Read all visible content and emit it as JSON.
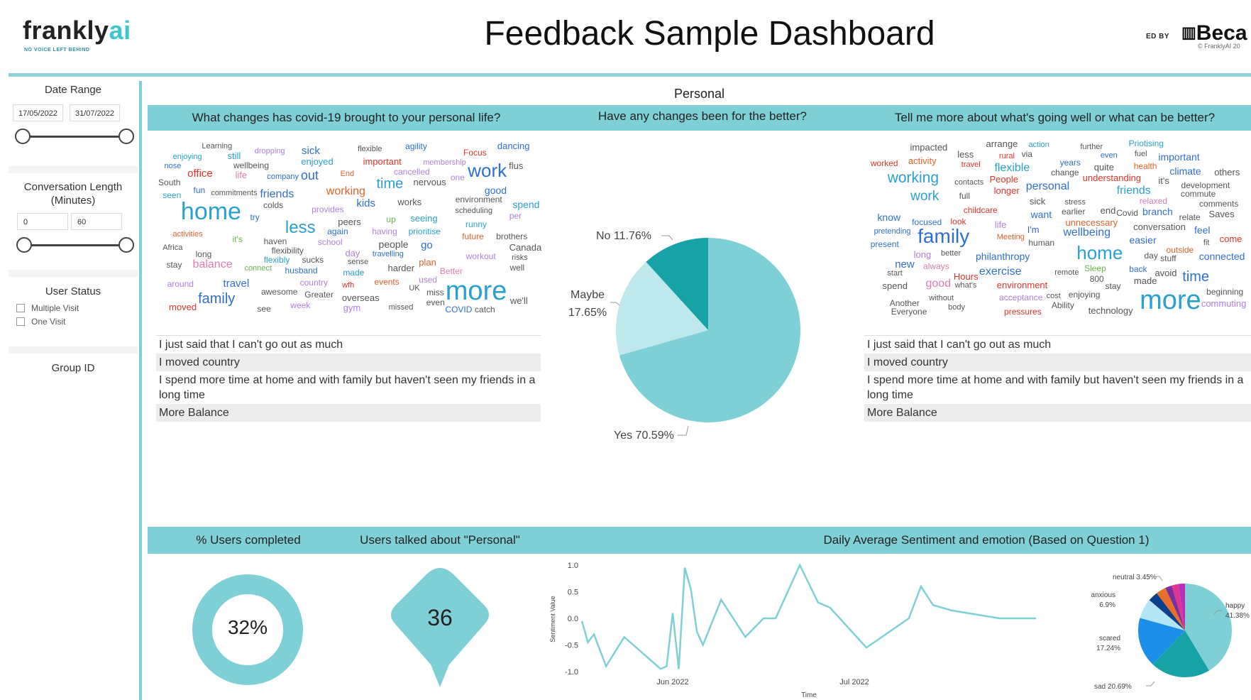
{
  "header": {
    "logo": "frankly",
    "logo_ai": "ai",
    "tagline": "NO VOICE LEFT BEHIND",
    "title": "Feedback Sample Dashboard",
    "powered_by": "ED BY",
    "partner": "Beca",
    "copyright": "© FranklyAI 20"
  },
  "sidebar": {
    "date_range": {
      "title": "Date Range",
      "start": "17/05/2022",
      "end": "31/07/2022"
    },
    "conversation_length": {
      "title_line1": "Conversation Length",
      "title_line2": "(Minutes)",
      "min": "0",
      "max": "60"
    },
    "user_status": {
      "title": "User Status",
      "options": [
        "Multiple Visit",
        "One Visit"
      ]
    },
    "group_id": {
      "title": "Group ID"
    }
  },
  "main": {
    "section": "Personal",
    "q1": "What changes has covid-19 brought to your personal life?",
    "q2": "Have any changes been for the better?",
    "q3": "Tell me more about what's going well or what can be better?",
    "responses_left": [
      "I just said that I can't go out as much",
      "I moved country",
      "I spend more time at home and with family but haven't seen my friends in a long time",
      "More Balance"
    ],
    "responses_right": [
      "I just said that I can't go out as much",
      "I moved country",
      "I spend more time at home and with family but haven't seen my friends in a long time",
      "More Balance"
    ],
    "kpi_band": {
      "users_completed_title": "% Users completed",
      "users_personal_title": "Users talked about \"Personal\"",
      "sentiment_title": "Daily Average Sentiment and emotion (Based on Question 1)"
    },
    "users_completed_value": "32%",
    "users_completed_fraction": 0.32,
    "users_personal_value": "36"
  },
  "wordcloud_left": [
    [
      "provides",
      "#b07fe0"
    ],
    [
      "life",
      "#e07bb0"
    ],
    [
      "used",
      "#b07fe0"
    ],
    [
      "gym",
      "#b07fe0"
    ],
    [
      "flexibility",
      "#555"
    ],
    [
      "country",
      "#b07fe0"
    ],
    [
      "out",
      "#2f6fd0"
    ],
    [
      "long",
      "#555"
    ],
    [
      "events",
      "#e0622a"
    ],
    [
      "membership",
      "#b07fe0"
    ],
    [
      "moved",
      "#e0342a"
    ],
    [
      "South",
      "#555"
    ],
    [
      "seen",
      "#2aa0d0"
    ],
    [
      "connect",
      "#6ab04c"
    ],
    [
      "flexible",
      "#555"
    ],
    [
      "week",
      "#b07fe0"
    ],
    [
      "sucks",
      "#555"
    ],
    [
      "workout",
      "#b07fe0"
    ],
    [
      "around",
      "#b07fe0"
    ],
    [
      "nose",
      "#2f6fd0"
    ],
    [
      "travel",
      "#2f6fd0"
    ],
    [
      "brothers",
      "#555"
    ],
    [
      "runny",
      "#2aa0d0"
    ],
    [
      "up",
      "#6ab04c"
    ],
    [
      "time",
      "#2aa0d0"
    ],
    [
      "harder",
      "#555"
    ],
    [
      "important",
      "#e0342a"
    ],
    [
      "future",
      "#e0622a"
    ],
    [
      "colds",
      "#555"
    ],
    [
      "dancing",
      "#2f6fd0"
    ],
    [
      "Focus",
      "#e0342a"
    ],
    [
      "environment",
      "#555"
    ],
    [
      "working",
      "#e0622a"
    ],
    [
      "spend",
      "#2aa0d0"
    ],
    [
      "overseas",
      "#555"
    ],
    [
      "scheduling",
      "#555"
    ],
    [
      "enjoyed",
      "#2aa0d0"
    ],
    [
      "kids",
      "#2f6fd0"
    ],
    [
      "again",
      "#2f6fd0"
    ],
    [
      "travelling",
      "#2f6fd0"
    ],
    [
      "still",
      "#2aa0d0"
    ],
    [
      "work",
      "#2f6fd0"
    ],
    [
      "fun",
      "#2f6fd0"
    ],
    [
      "dropping",
      "#b07fe0"
    ],
    [
      "flexibly",
      "#2aa0d0"
    ],
    [
      "it's",
      "#6ab04c"
    ],
    [
      "agility",
      "#2f6fd0"
    ],
    [
      "see",
      "#555"
    ],
    [
      "well",
      "#555"
    ],
    [
      "people",
      "#555"
    ],
    [
      "go",
      "#2f6fd0"
    ],
    [
      "balance",
      "#e07bb0"
    ],
    [
      "prioritise",
      "#2aa0d0"
    ],
    [
      "haven",
      "#555"
    ],
    [
      "enjoying",
      "#2aa0d0"
    ],
    [
      "flus",
      "#555"
    ],
    [
      "commitments",
      "#555"
    ],
    [
      "made",
      "#2aa0d0"
    ],
    [
      "even",
      "#555"
    ],
    [
      "company",
      "#2f6fd0"
    ],
    [
      "Learning",
      "#555"
    ],
    [
      "activities",
      "#e0622a"
    ],
    [
      "school",
      "#b07fe0"
    ],
    [
      "sense",
      "#555"
    ],
    [
      "works",
      "#555"
    ],
    [
      "home",
      "#2aa0d0"
    ],
    [
      "nervous",
      "#555"
    ],
    [
      "Better",
      "#e07bb0"
    ],
    [
      "office",
      "#e0342a"
    ],
    [
      "peers",
      "#555"
    ],
    [
      "husband",
      "#2f6fd0"
    ],
    [
      "Greater",
      "#555"
    ],
    [
      "catch",
      "#555"
    ],
    [
      "seeing",
      "#2aa0d0"
    ],
    [
      "sick",
      "#2f6fd0"
    ],
    [
      "End",
      "#e0622a"
    ],
    [
      "missed",
      "#555"
    ],
    [
      "Canada",
      "#555"
    ],
    [
      "UK",
      "#555"
    ],
    [
      "one",
      "#b07fe0"
    ],
    [
      "good",
      "#2f6fd0"
    ],
    [
      "COVID",
      "#2f6fd0"
    ],
    [
      "plan",
      "#e0622a"
    ],
    [
      "cancelled",
      "#b07fe0"
    ],
    [
      "friends",
      "#2f6fd0"
    ],
    [
      "wfh",
      "#e0342a"
    ],
    [
      "wellbeing",
      "#555"
    ],
    [
      "more",
      "#2aa0d0"
    ],
    [
      "day",
      "#b07fe0"
    ],
    [
      "miss",
      "#555"
    ],
    [
      "family",
      "#2f6fd0"
    ],
    [
      "per",
      "#b07fe0"
    ],
    [
      "having",
      "#b07fe0"
    ],
    [
      "less",
      "#2aa0d0"
    ],
    [
      "we'll",
      "#555"
    ],
    [
      "stay",
      "#555"
    ],
    [
      "try",
      "#2f6fd0"
    ],
    [
      "Africa",
      "#555"
    ],
    [
      "awesome",
      "#555"
    ],
    [
      "risks",
      "#555"
    ]
  ],
  "wordcloud_right": [
    [
      "outside",
      "#e0622a"
    ],
    [
      "Meeting",
      "#e0622a"
    ],
    [
      "cost",
      "#555"
    ],
    [
      "even",
      "#2f6fd0"
    ],
    [
      "enjoying",
      "#555"
    ],
    [
      "good",
      "#e07bb0"
    ],
    [
      "day",
      "#555"
    ],
    [
      "arrange",
      "#555"
    ],
    [
      "acceptance",
      "#b07fe0"
    ],
    [
      "Sleep",
      "#6ab04c"
    ],
    [
      "years",
      "#2f6fd0"
    ],
    [
      "fuel",
      "#555"
    ],
    [
      "look",
      "#e0342a"
    ],
    [
      "health",
      "#e0622a"
    ],
    [
      "earlier",
      "#555"
    ],
    [
      "longer",
      "#e0342a"
    ],
    [
      "long",
      "#b07fe0"
    ],
    [
      "friends",
      "#2aa0d0"
    ],
    [
      "conversation",
      "#555"
    ],
    [
      "work",
      "#2aa0d0"
    ],
    [
      "technology",
      "#555"
    ],
    [
      "avoid",
      "#555"
    ],
    [
      "life",
      "#b07fe0"
    ],
    [
      "commute",
      "#555"
    ],
    [
      "People",
      "#e0342a"
    ],
    [
      "always",
      "#e07bb0"
    ],
    [
      "impacted",
      "#555"
    ],
    [
      "travel",
      "#e0342a"
    ],
    [
      "via",
      "#555"
    ],
    [
      "childcare",
      "#e0342a"
    ],
    [
      "Saves",
      "#555"
    ],
    [
      "body",
      "#555"
    ],
    [
      "personal",
      "#2f6fd0"
    ],
    [
      "easier",
      "#2f6fd0"
    ],
    [
      "stay",
      "#555"
    ],
    [
      "Another",
      "#555"
    ],
    [
      "full",
      "#555"
    ],
    [
      "it's",
      "#555"
    ],
    [
      "end",
      "#555"
    ],
    [
      "know",
      "#2f6fd0"
    ],
    [
      "important",
      "#2f6fd0"
    ],
    [
      "branch",
      "#2f6fd0"
    ],
    [
      "time",
      "#2f6fd0"
    ],
    [
      "focused",
      "#2f6fd0"
    ],
    [
      "commuting",
      "#b07fe0"
    ],
    [
      "further",
      "#555"
    ],
    [
      "Everyone",
      "#555"
    ],
    [
      "I'm",
      "#2f6fd0"
    ],
    [
      "Ability",
      "#555"
    ],
    [
      "new",
      "#2f6fd0"
    ],
    [
      "Priotising",
      "#2aa0d0"
    ],
    [
      "action",
      "#2aa0d0"
    ],
    [
      "quite",
      "#555"
    ],
    [
      "stress",
      "#555"
    ],
    [
      "development",
      "#555"
    ],
    [
      "without",
      "#555"
    ],
    [
      "remote",
      "#555"
    ],
    [
      "what's",
      "#555"
    ],
    [
      "contacts",
      "#555"
    ],
    [
      "relaxed",
      "#e07bb0"
    ],
    [
      "relate",
      "#555"
    ],
    [
      "spend",
      "#555"
    ],
    [
      "start",
      "#555"
    ],
    [
      "family",
      "#2f6fd0"
    ],
    [
      "pressures",
      "#e0342a"
    ],
    [
      "comments",
      "#555"
    ],
    [
      "exercise",
      "#2f6fd0"
    ],
    [
      "fit",
      "#555"
    ],
    [
      "connected",
      "#2f6fd0"
    ],
    [
      "understanding",
      "#e0342a"
    ],
    [
      "activity",
      "#e0622a"
    ],
    [
      "800",
      "#555"
    ],
    [
      "made",
      "#555"
    ],
    [
      "less",
      "#555"
    ],
    [
      "feel",
      "#2f6fd0"
    ],
    [
      "stuff",
      "#555"
    ],
    [
      "Covid",
      "#555"
    ],
    [
      "environment",
      "#e0342a"
    ],
    [
      "change",
      "#555"
    ],
    [
      "others",
      "#555"
    ],
    [
      "want",
      "#2f6fd0"
    ],
    [
      "present",
      "#2f6fd0"
    ],
    [
      "human",
      "#555"
    ],
    [
      "unnecessary",
      "#e0622a"
    ],
    [
      "flexible",
      "#2aa0d0"
    ],
    [
      "sick",
      "#555"
    ],
    [
      "more",
      "#2aa0d0"
    ],
    [
      "come",
      "#e0342a"
    ],
    [
      "wellbeing",
      "#2f6fd0"
    ],
    [
      "rural",
      "#e0342a"
    ],
    [
      "Hours",
      "#e0342a"
    ],
    [
      "working",
      "#2aa0d0"
    ],
    [
      "home",
      "#2aa0d0"
    ],
    [
      "better",
      "#555"
    ],
    [
      "back",
      "#2f6fd0"
    ],
    [
      "climate",
      "#2f6fd0"
    ],
    [
      "worked",
      "#e0342a"
    ],
    [
      "philanthropy",
      "#2f6fd0"
    ],
    [
      "beginning",
      "#555"
    ],
    [
      "pretending",
      "#2f6fd0"
    ]
  ],
  "chart_data": [
    {
      "type": "pie",
      "title": "Have any changes been for the better?",
      "labels": [
        "Yes",
        "Maybe",
        "No"
      ],
      "values": [
        70.59,
        17.65,
        11.76
      ],
      "display_labels": [
        "Yes 70.59%",
        "Maybe 17.65%",
        "No 11.76%"
      ],
      "colors": [
        "#7fd0d6",
        "#bfe8ec",
        "#17a3a6"
      ]
    },
    {
      "type": "line",
      "title": "Daily Average Sentiment and emotion (Based on Question 1)",
      "xlabel": "Time",
      "ylabel": "Sentiment Value",
      "ylim": [
        -1.0,
        1.0
      ],
      "yticks": [
        "1.0",
        "0.5",
        "0.0",
        "-0.5",
        "-1.0"
      ],
      "xticks": [
        "Jun 2022",
        "Jul 2022"
      ],
      "x": [
        "2022-05-17",
        "2022-05-18",
        "2022-05-19",
        "2022-05-21",
        "2022-05-24",
        "2022-05-30",
        "2022-05-31",
        "2022-06-01",
        "2022-06-02",
        "2022-06-03",
        "2022-06-04",
        "2022-06-05",
        "2022-06-06",
        "2022-06-09",
        "2022-06-13",
        "2022-06-16",
        "2022-06-18",
        "2022-06-22",
        "2022-06-25",
        "2022-06-27",
        "2022-07-03",
        "2022-07-10",
        "2022-07-12",
        "2022-07-14",
        "2022-07-17",
        "2022-07-25",
        "2022-07-31"
      ],
      "y": [
        -0.05,
        -0.45,
        -0.3,
        -0.9,
        -0.35,
        -0.95,
        -0.9,
        0.1,
        -0.95,
        0.95,
        0.55,
        -0.25,
        -0.5,
        0.35,
        -0.35,
        0.0,
        0.0,
        1.0,
        0.3,
        0.2,
        -0.55,
        0.0,
        0.6,
        0.25,
        0.15,
        0.0,
        0.0
      ],
      "color": "#7fd0d6"
    },
    {
      "type": "pie",
      "title": "Emotion",
      "labels": [
        "happy",
        "sad",
        "scared",
        "anxious",
        "neutral",
        "other1",
        "other2",
        "other3",
        "other4"
      ],
      "values": [
        41.38,
        20.69,
        17.24,
        6.9,
        3.45,
        3.45,
        2.3,
        2.3,
        2.29
      ],
      "display_labels": [
        "happy 41.38%",
        "sad 20.69%",
        "scared 17.24%",
        "anxious 6.9%",
        "neutral 3.45%"
      ],
      "colors": [
        "#7fd0d6",
        "#17a3a6",
        "#1e8fe8",
        "#b3e6f2",
        "#0d3f8a",
        "#e8702a",
        "#7a2f9e",
        "#e0358f",
        "#b52fb8"
      ]
    }
  ]
}
